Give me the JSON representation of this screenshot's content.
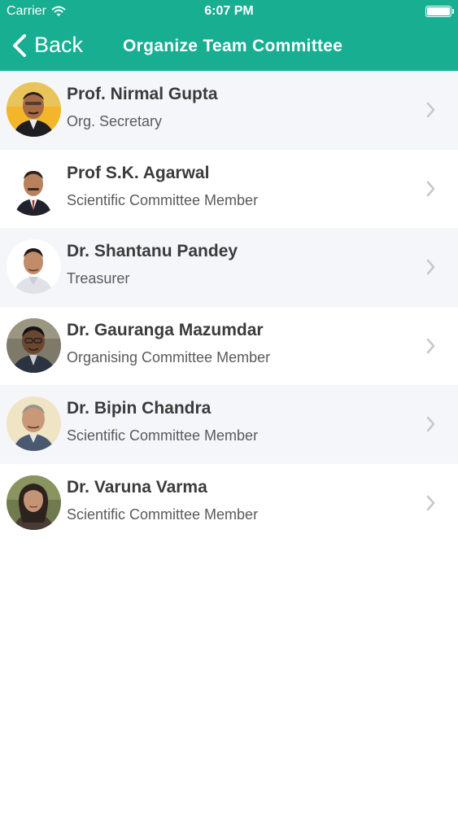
{
  "status_bar": {
    "carrier": "Carrier",
    "time": "6:07 PM"
  },
  "nav": {
    "back_label": "Back",
    "title": "Organize Team Committee"
  },
  "colors": {
    "header": "#17ae92",
    "row_alt": "#f5f6fa",
    "name_text": "#3b3b3b",
    "role_text": "#5a5a5a",
    "chevron": "#c7c7cc"
  },
  "members": [
    {
      "name": "Prof. Nirmal Gupta",
      "role": "Org. Secretary"
    },
    {
      "name": "Prof S.K. Agarwal",
      "role": "Scientific Committee Member"
    },
    {
      "name": "Dr. Shantanu Pandey",
      "role": "Treasurer"
    },
    {
      "name": "Dr. Gauranga Mazumdar",
      "role": "Organising Committee Member"
    },
    {
      "name": "Dr. Bipin Chandra",
      "role": "Scientific Committee Member"
    },
    {
      "name": "Dr. Varuna Varma",
      "role": "Scientific Committee Member"
    }
  ]
}
